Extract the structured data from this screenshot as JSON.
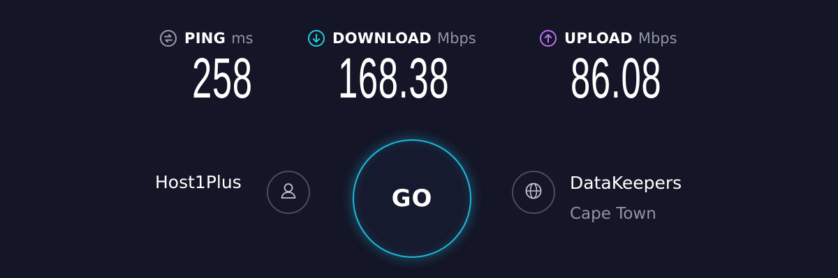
{
  "metrics": {
    "ping": {
      "label": "PING",
      "unit": "ms",
      "value": "258",
      "icon": "ping-icon",
      "color": "#9a9cb0"
    },
    "download": {
      "label": "DOWNLOAD",
      "unit": "Mbps",
      "value": "168.38",
      "icon": "download-arrow-icon",
      "color": "#1fd1e0"
    },
    "upload": {
      "label": "UPLOAD",
      "unit": "Mbps",
      "value": "86.08",
      "icon": "upload-arrow-icon",
      "color": "#bf71f4"
    }
  },
  "isp": {
    "name": "Host1Plus",
    "icon": "user-icon"
  },
  "go_button": {
    "label": "GO",
    "accent": "#1fb9d9"
  },
  "server": {
    "name": "DataKeepers",
    "location": "Cape Town",
    "icon": "globe-icon"
  },
  "colors": {
    "background": "#141526",
    "muted_text": "#9193a8"
  }
}
